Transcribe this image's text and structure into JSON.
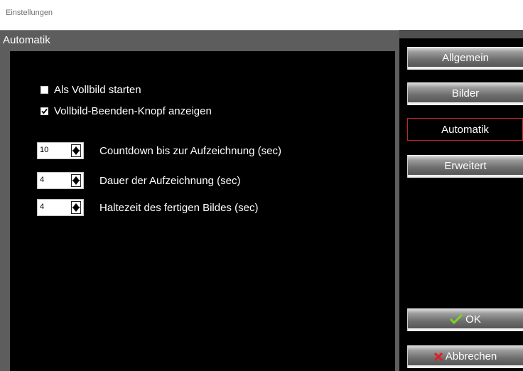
{
  "window": {
    "title": "Einstellungen"
  },
  "panel": {
    "title": "Automatik"
  },
  "checkboxes": [
    {
      "label": "Als Vollbild starten",
      "checked": false
    },
    {
      "label": "Vollbild-Beenden-Knopf anzeigen",
      "checked": true
    }
  ],
  "spinners": [
    {
      "value": "10",
      "label": "Countdown bis zur Aufzeichnung (sec)"
    },
    {
      "value": "4",
      "label": "Dauer der Aufzeichnung (sec)"
    },
    {
      "value": "4",
      "label": "Haltezeit des fertigen Bildes (sec)"
    }
  ],
  "nav": {
    "allgemein": "Allgemein",
    "bilder": "Bilder",
    "automatik": "Automatik",
    "erweitert": "Erweitert",
    "active": "automatik"
  },
  "actions": {
    "ok": "OK",
    "cancel": "Abbrechen"
  },
  "colors": {
    "accent": "#c0282b",
    "ok_icon": "#7fd321",
    "cancel_icon": "#e02020"
  }
}
